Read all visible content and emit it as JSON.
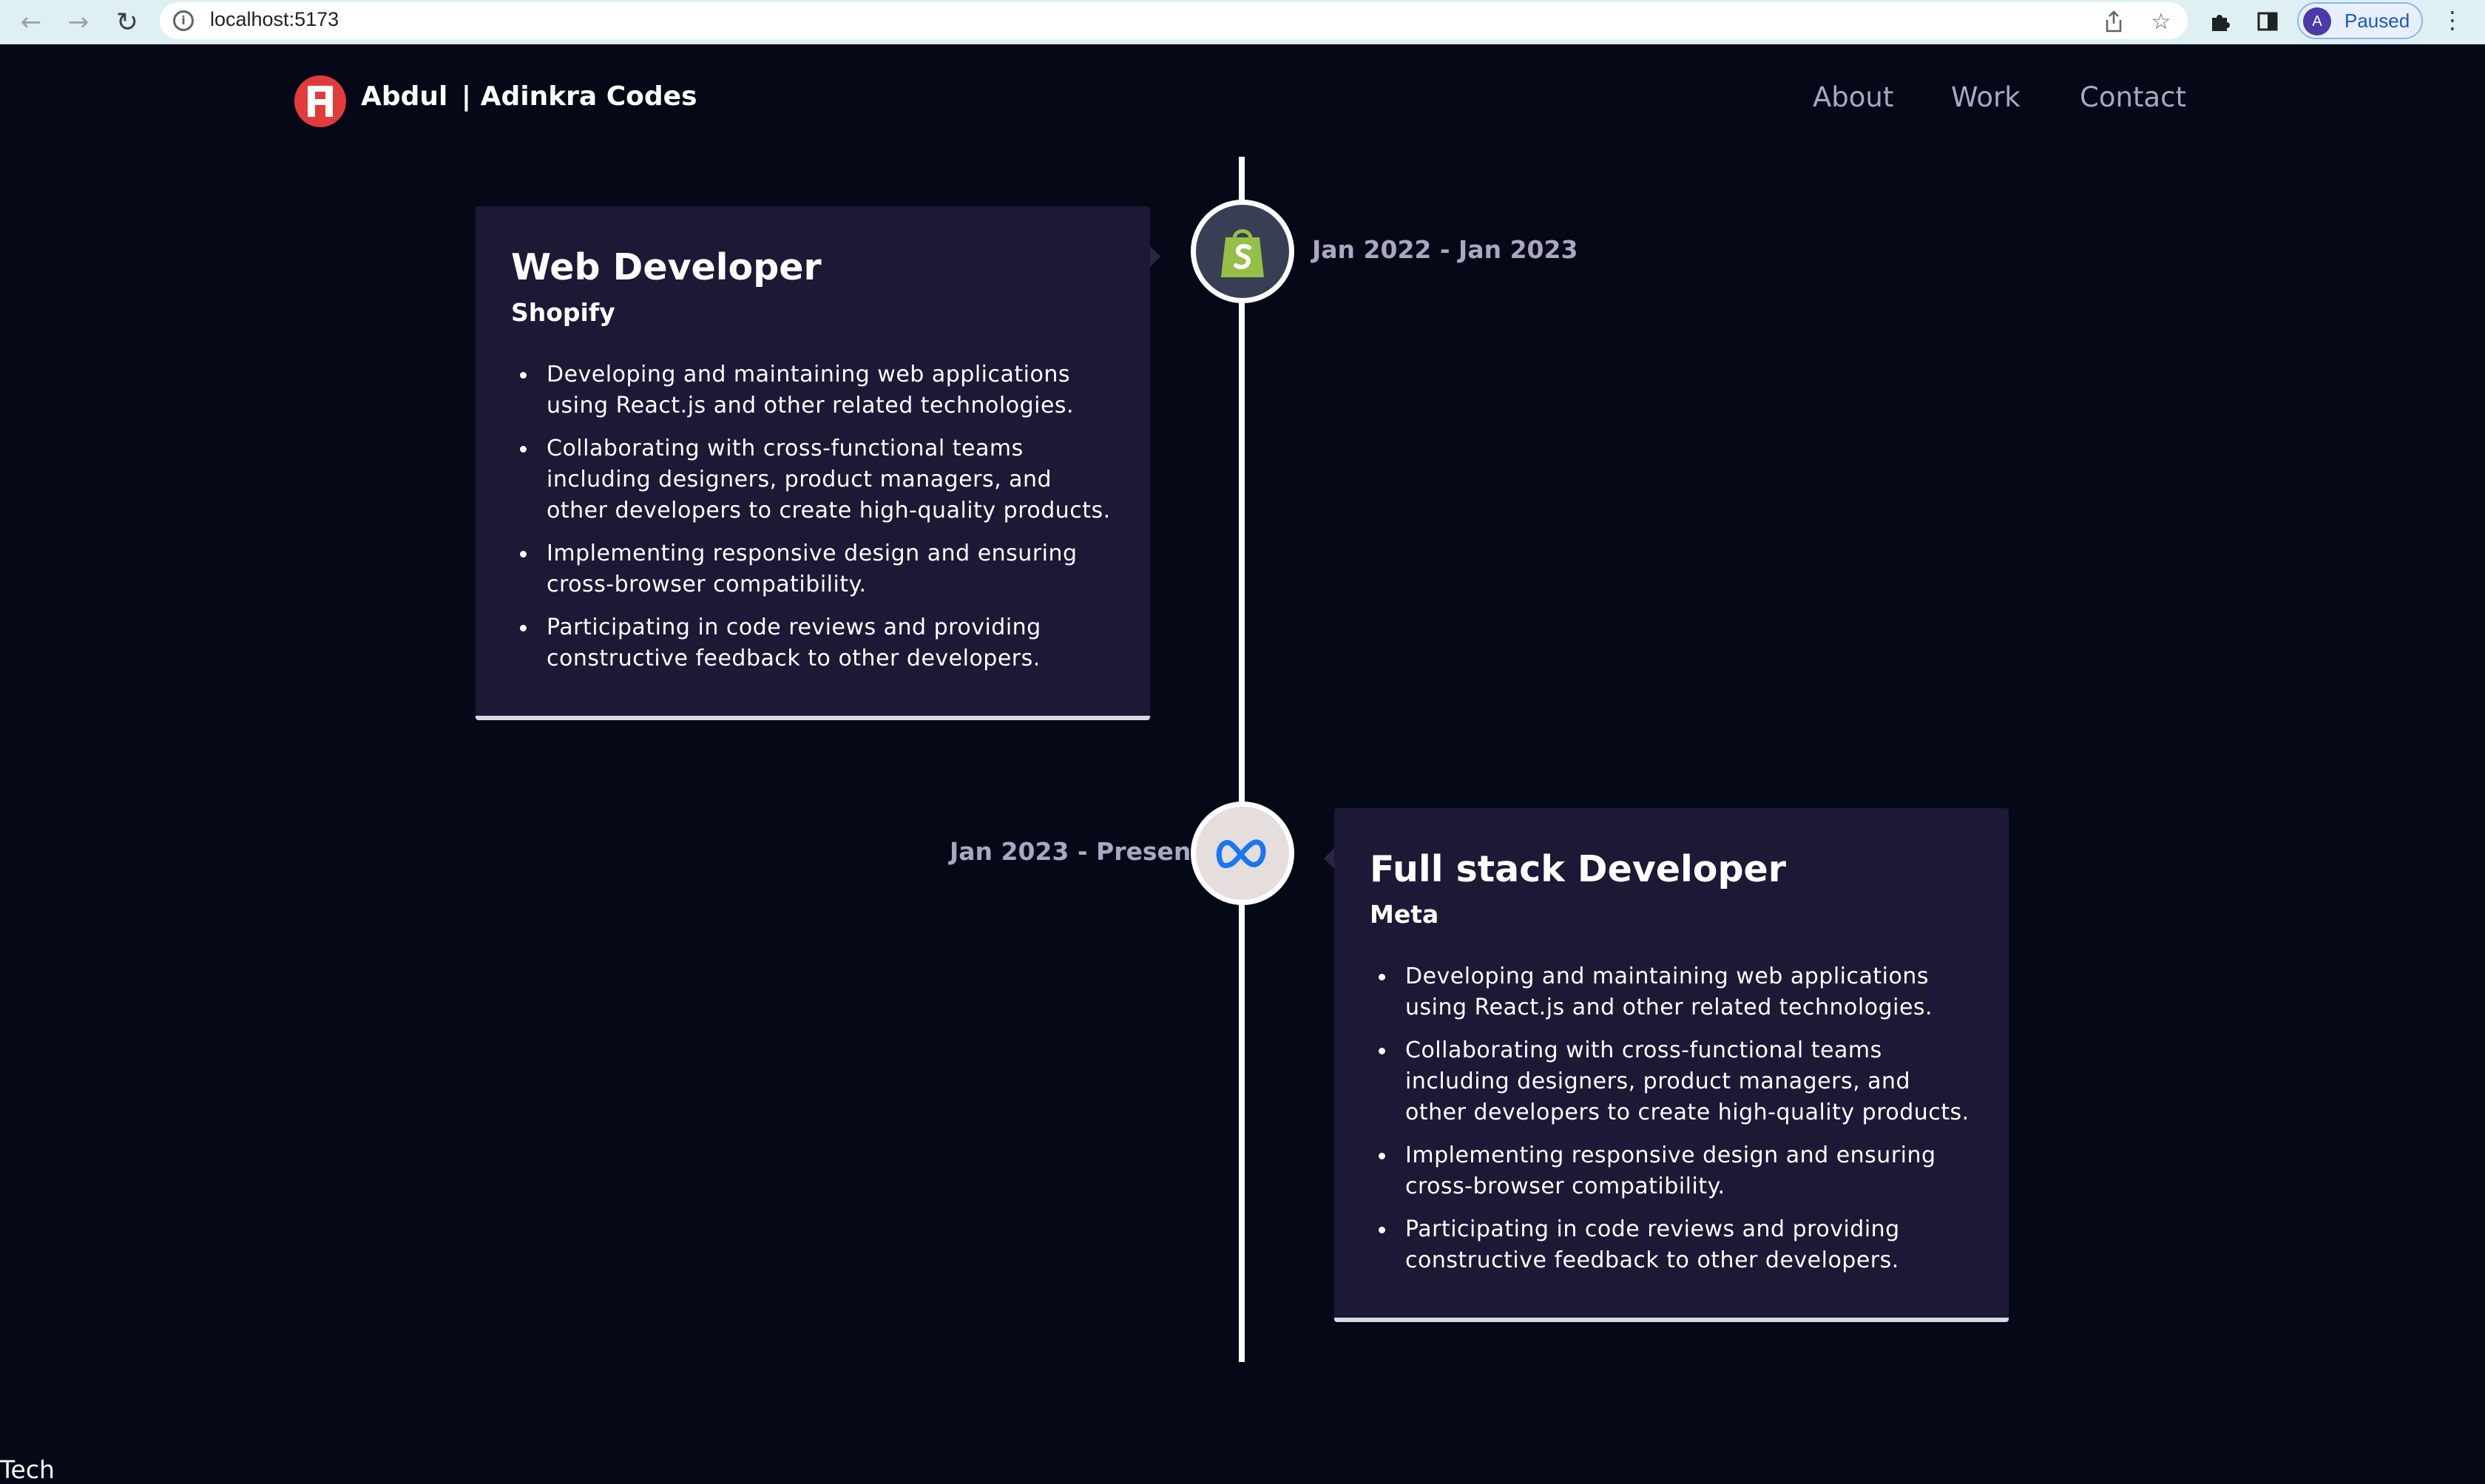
{
  "browser": {
    "url": "localhost:5173",
    "profile_initial": "A",
    "profile_status": "Paused",
    "icons": {
      "back": "back-arrow-icon",
      "forward": "forward-arrow-icon",
      "reload": "reload-icon",
      "site_info": "info-icon",
      "share": "share-icon",
      "bookmark": "star-icon",
      "extensions": "puzzle-icon",
      "side_panel": "side-panel-icon",
      "menu": "kebab-menu-icon"
    }
  },
  "header": {
    "brand_name": "Abdul",
    "brand_suffix": "| Adinkra Codes",
    "logo_color": "#e23b3b",
    "nav": [
      {
        "label": "About"
      },
      {
        "label": "Work"
      },
      {
        "label": "Contact"
      }
    ]
  },
  "experiences": [
    {
      "title": "Web Developer",
      "company": "Shopify",
      "date": "Jan 2022 - Jan 2023",
      "icon": "shopify-bag-icon",
      "icon_bg": "#383e56",
      "points": [
        "Developing and maintaining web applications using React.js and other related technologies.",
        "Collaborating with cross-functional teams including designers, product managers, and other developers to create high-quality products.",
        "Implementing responsive design and ensuring cross-browser compatibility.",
        "Participating in code reviews and providing constructive feedback to other developers."
      ]
    },
    {
      "title": "Full stack Developer",
      "company": "Meta",
      "date": "Jan 2023 - Present",
      "icon": "meta-infinity-icon",
      "icon_bg": "#e6dedd",
      "points": [
        "Developing and maintaining web applications using React.js and other related technologies.",
        "Collaborating with cross-functional teams including designers, product managers, and other developers to create high-quality products.",
        "Implementing responsive design and ensuring cross-browser compatibility.",
        "Participating in code reviews and providing constructive feedback to other developers."
      ]
    }
  ],
  "footer_text": "Tech",
  "colors": {
    "background": "#050816",
    "card": "#1d1836",
    "secondary_text": "#aaa6c3",
    "timeline": "#ffffff"
  }
}
